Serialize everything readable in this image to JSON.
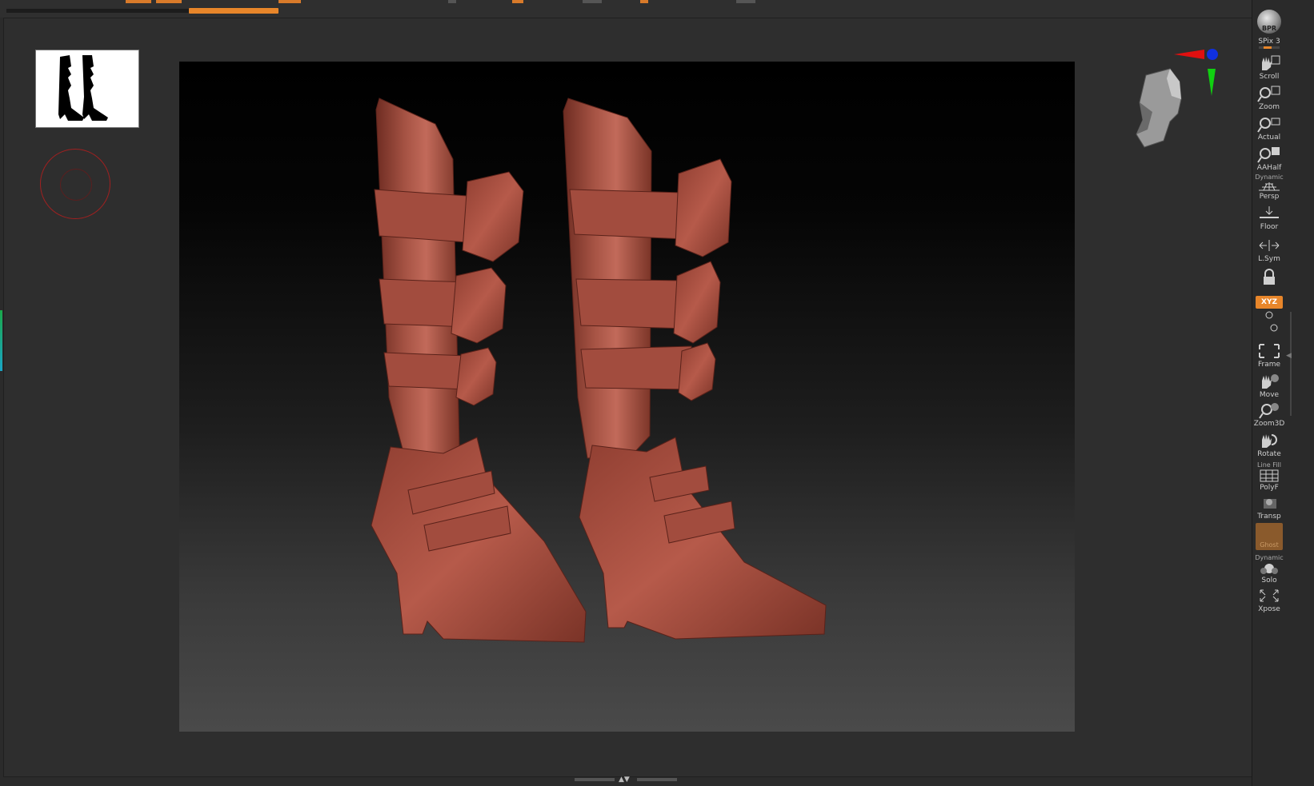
{
  "canvas": {
    "thumbnail_name": "boots-silhouette-thumbnail",
    "model_name": "boots-3d-model",
    "model_color": "#9a4536"
  },
  "right_shelf": {
    "bpr": {
      "label": "BPR"
    },
    "spix": {
      "label": "SPix 3"
    },
    "scroll": {
      "label": "Scroll"
    },
    "zoom": {
      "label": "Zoom"
    },
    "actual": {
      "label": "Actual"
    },
    "aahalf": {
      "label": "AAHalf"
    },
    "persp": {
      "label": "Persp",
      "over": "Dynamic"
    },
    "floor": {
      "label": "Floor"
    },
    "lsym": {
      "label": "L.Sym"
    },
    "xyz": {
      "label": "XYZ"
    },
    "frame": {
      "label": "Frame"
    },
    "move": {
      "label": "Move"
    },
    "zoom3d": {
      "label": "Zoom3D"
    },
    "rotate": {
      "label": "Rotate"
    },
    "polyf": {
      "label": "PolyF",
      "over": "Line Fill"
    },
    "transp": {
      "label": "Transp"
    },
    "ghost": {
      "label": "Ghost"
    },
    "solo": {
      "label": "Solo",
      "over": "Dynamic"
    },
    "xpose": {
      "label": "Xpose"
    }
  },
  "colors": {
    "accent": "#e8862a",
    "axis_x": "#e01010",
    "axis_y": "#10d010",
    "axis_z": "#1030e0"
  }
}
